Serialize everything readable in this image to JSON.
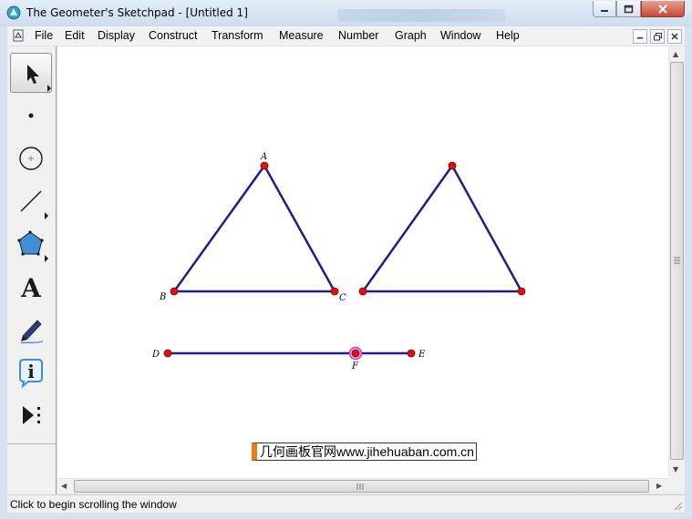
{
  "window": {
    "title": "The Geometer's Sketchpad - [Untitled 1]"
  },
  "menubar": {
    "items": [
      "File",
      "Edit",
      "Display",
      "Construct",
      "Transform",
      "Measure",
      "Number",
      "Graph",
      "Window",
      "Help"
    ]
  },
  "toolbox": {
    "tools": [
      {
        "name": "arrow-tool",
        "icon": "arrow-select-icon",
        "selected": true
      },
      {
        "name": "point-tool",
        "icon": "point-icon"
      },
      {
        "name": "compass-tool",
        "icon": "circle-icon"
      },
      {
        "name": "straightedge-tool",
        "icon": "segment-icon"
      },
      {
        "name": "polygon-tool",
        "icon": "polygon-icon"
      },
      {
        "name": "text-tool",
        "icon": "text-A-icon",
        "label": "A"
      },
      {
        "name": "marker-tool",
        "icon": "marker-pen-icon"
      },
      {
        "name": "information-tool",
        "icon": "info-icon",
        "label": "i"
      },
      {
        "name": "custom-tool",
        "icon": "custom-tool-play-icon"
      }
    ]
  },
  "sketch": {
    "points": {
      "A": "A",
      "B": "B",
      "C": "C",
      "D": "D",
      "E": "E",
      "F": "F"
    },
    "colors": {
      "segment": "#1f1f8a",
      "point": "#e01010",
      "selected_point": "#cc33cc"
    }
  },
  "watermark": {
    "text": "几何画板官网www.jihehuaban.com.cn"
  },
  "statusbar": {
    "text": "Click to begin scrolling the window"
  }
}
